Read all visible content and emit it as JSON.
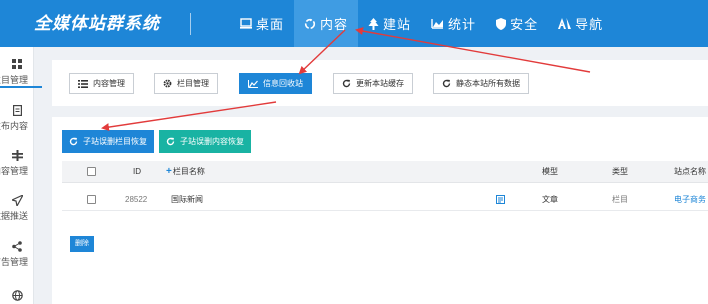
{
  "header": {
    "logo": "全媒体站群系统",
    "nav": [
      {
        "label": "桌面",
        "icon": "desktop-icon",
        "active": false
      },
      {
        "label": "内容",
        "icon": "recycle-icon",
        "active": true
      },
      {
        "label": "建站",
        "icon": "tree-icon",
        "active": false
      },
      {
        "label": "统计",
        "icon": "chart-icon",
        "active": false
      },
      {
        "label": "安全",
        "icon": "shield-icon",
        "active": false
      },
      {
        "label": "导航",
        "icon": "navigate-icon",
        "active": false
      }
    ]
  },
  "sidebar": {
    "items": [
      {
        "label": "栏目管理",
        "icon": "grid-icon",
        "active": true
      },
      {
        "label": "发布内容",
        "icon": "document-icon",
        "active": false
      },
      {
        "label": "内容管理",
        "icon": "plus-icon",
        "active": false
      },
      {
        "label": "数据推送",
        "icon": "send-icon",
        "active": false
      },
      {
        "label": "广告管理",
        "icon": "share-icon",
        "active": false
      },
      {
        "label": "",
        "icon": "globe-icon",
        "active": false
      }
    ]
  },
  "toolbar": {
    "buttons": [
      {
        "label": "内容管理",
        "icon": "list-icon",
        "primary": false
      },
      {
        "label": "栏目管理",
        "icon": "gear-icon",
        "primary": false
      },
      {
        "label": "信息回收站",
        "icon": "area-chart-icon",
        "primary": true
      },
      {
        "label": "更新本站缓存",
        "icon": "refresh-icon",
        "primary": false
      },
      {
        "label": "静态本站所有数据",
        "icon": "refresh-icon",
        "primary": false
      }
    ]
  },
  "actions": {
    "restore_columns": "子站误删栏目恢复",
    "restore_contents": "子站误删内容恢复"
  },
  "table": {
    "headers": {
      "id": "ID",
      "name": "栏目名称",
      "model": "模型",
      "type": "类型",
      "site": "站点名称"
    },
    "rows": [
      {
        "id": "28522",
        "name": "国际新闻",
        "model": "文章",
        "type": "栏目",
        "site": "电子商务"
      }
    ]
  },
  "delete_label": "删除",
  "colors": {
    "brand": "#1e86d7",
    "teal": "#19b3a3",
    "arrow": "#e23b3b"
  }
}
